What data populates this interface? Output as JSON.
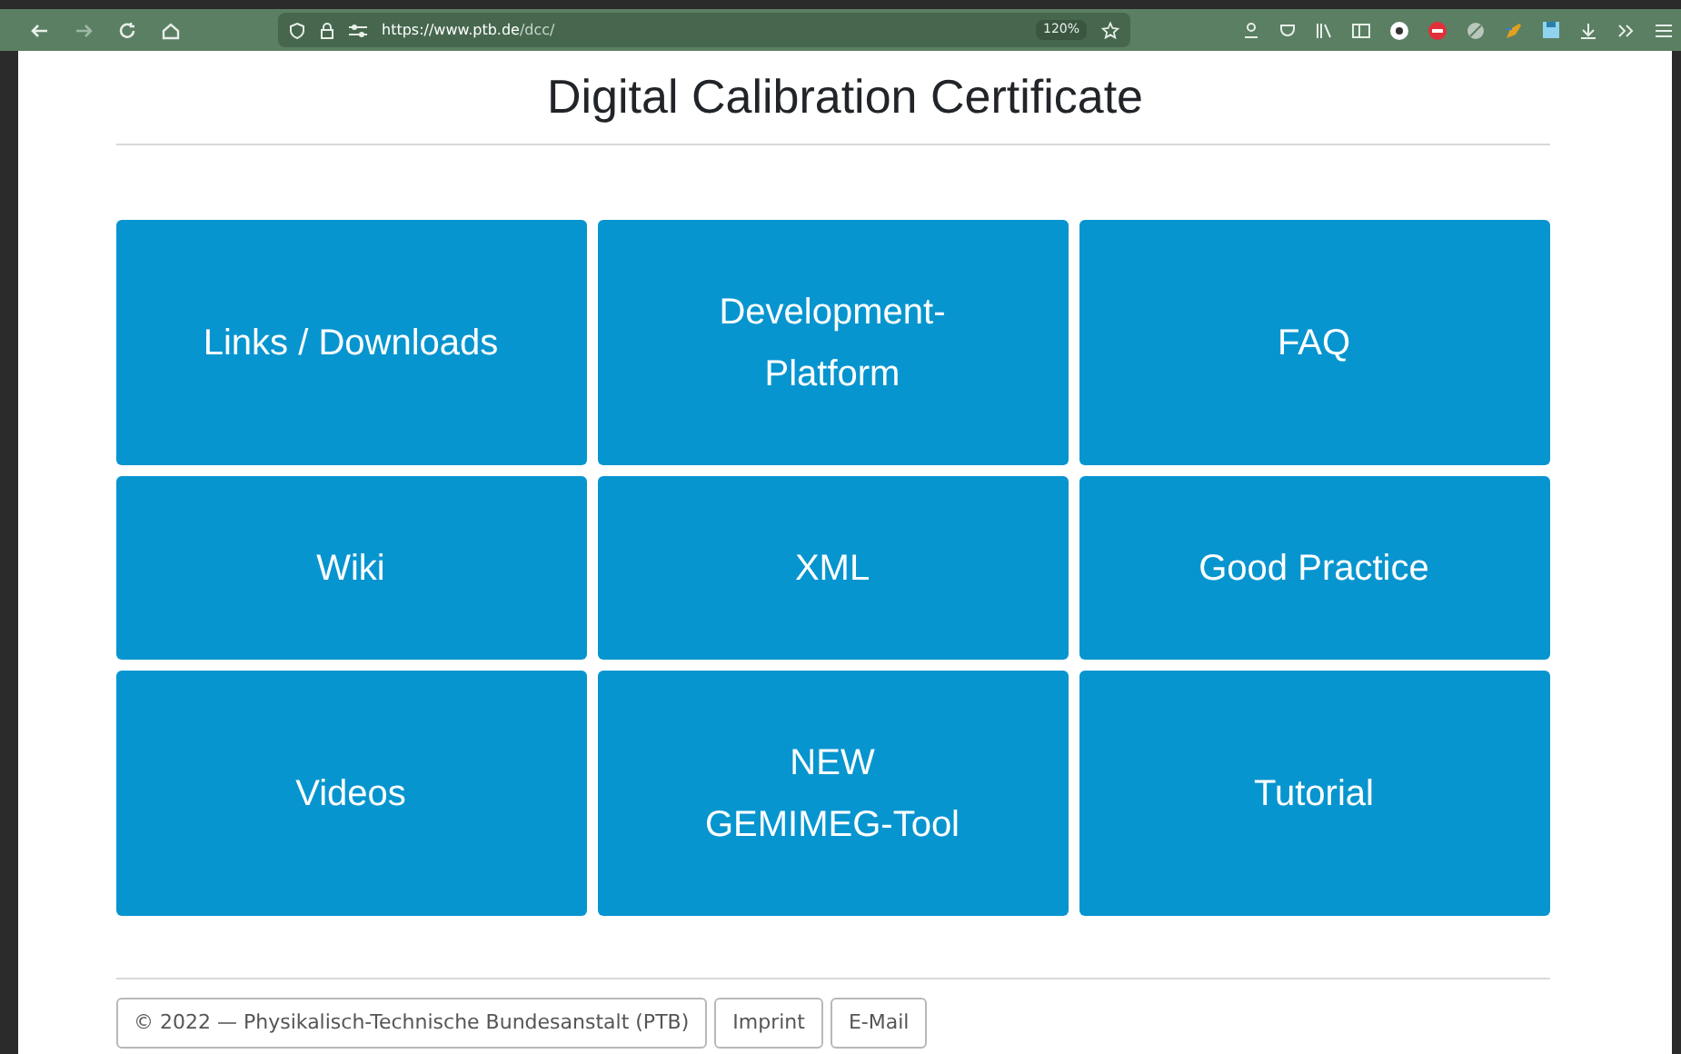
{
  "browser": {
    "url_host": "https://www.ptb.de",
    "url_path": "/dcc/",
    "zoom": "120%"
  },
  "page": {
    "title": "Digital Calibration Certificate",
    "tiles": [
      {
        "lines": [
          "Links / Downloads"
        ]
      },
      {
        "lines": [
          "Development-",
          "Platform"
        ]
      },
      {
        "lines": [
          "FAQ"
        ]
      },
      {
        "lines": [
          "Wiki"
        ]
      },
      {
        "lines": [
          "XML"
        ]
      },
      {
        "lines": [
          "Good Practice"
        ]
      },
      {
        "lines": [
          "Videos"
        ]
      },
      {
        "lines": [
          "NEW",
          "GEMIMEG-Tool"
        ]
      },
      {
        "lines": [
          "Tutorial"
        ]
      }
    ],
    "footer": [
      "© 2022 — Physikalisch-Technische Bundesanstalt (PTB)",
      "Imprint",
      "E-Mail"
    ]
  }
}
